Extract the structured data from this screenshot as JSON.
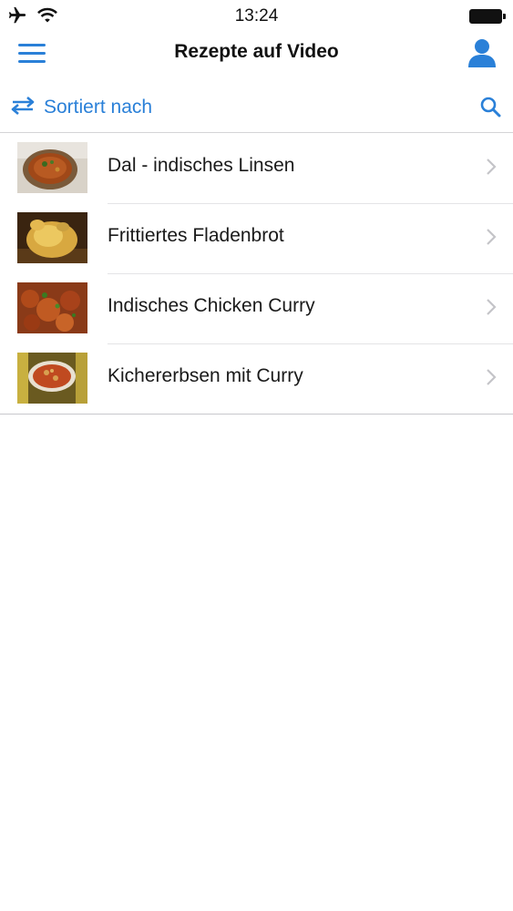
{
  "status_bar": {
    "time": "13:24",
    "icons": [
      "airplane-icon",
      "wifi-icon",
      "battery-icon"
    ]
  },
  "nav": {
    "title": "Rezepte auf Video",
    "left_icon": "menu-icon",
    "right_icon": "user-icon"
  },
  "toolbar": {
    "sort_label": "Sortiert nach",
    "sort_icon": "swap-arrows-icon",
    "search_icon": "search-icon"
  },
  "recipes": [
    {
      "title": "Dal - indisches Linsen"
    },
    {
      "title": "Frittiertes Fladenbrot"
    },
    {
      "title": "Indisches Chicken Curry"
    },
    {
      "title": "Kichererbsen mit Curry"
    }
  ],
  "colors": {
    "accent": "#2a80d8",
    "separator": "#d4d4d6",
    "text": "#1a1a1a"
  }
}
